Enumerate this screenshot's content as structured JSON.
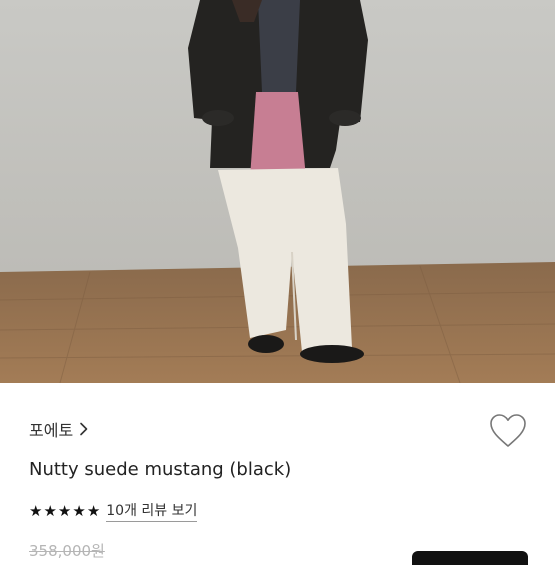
{
  "product": {
    "brand": "포에토",
    "title": "Nutty suede mustang (black)",
    "rating_stars": 5,
    "review_link": "10개 리뷰 보기",
    "original_price": "358,000원"
  },
  "icons": {
    "brand_chevron": "chevron-right-icon",
    "wishlist": "heart-outline-icon",
    "star": "star-filled-icon"
  },
  "colors": {
    "background": "#ffffff",
    "text": "#222222",
    "muted_price": "#b5b5b5",
    "star": "#111111"
  }
}
